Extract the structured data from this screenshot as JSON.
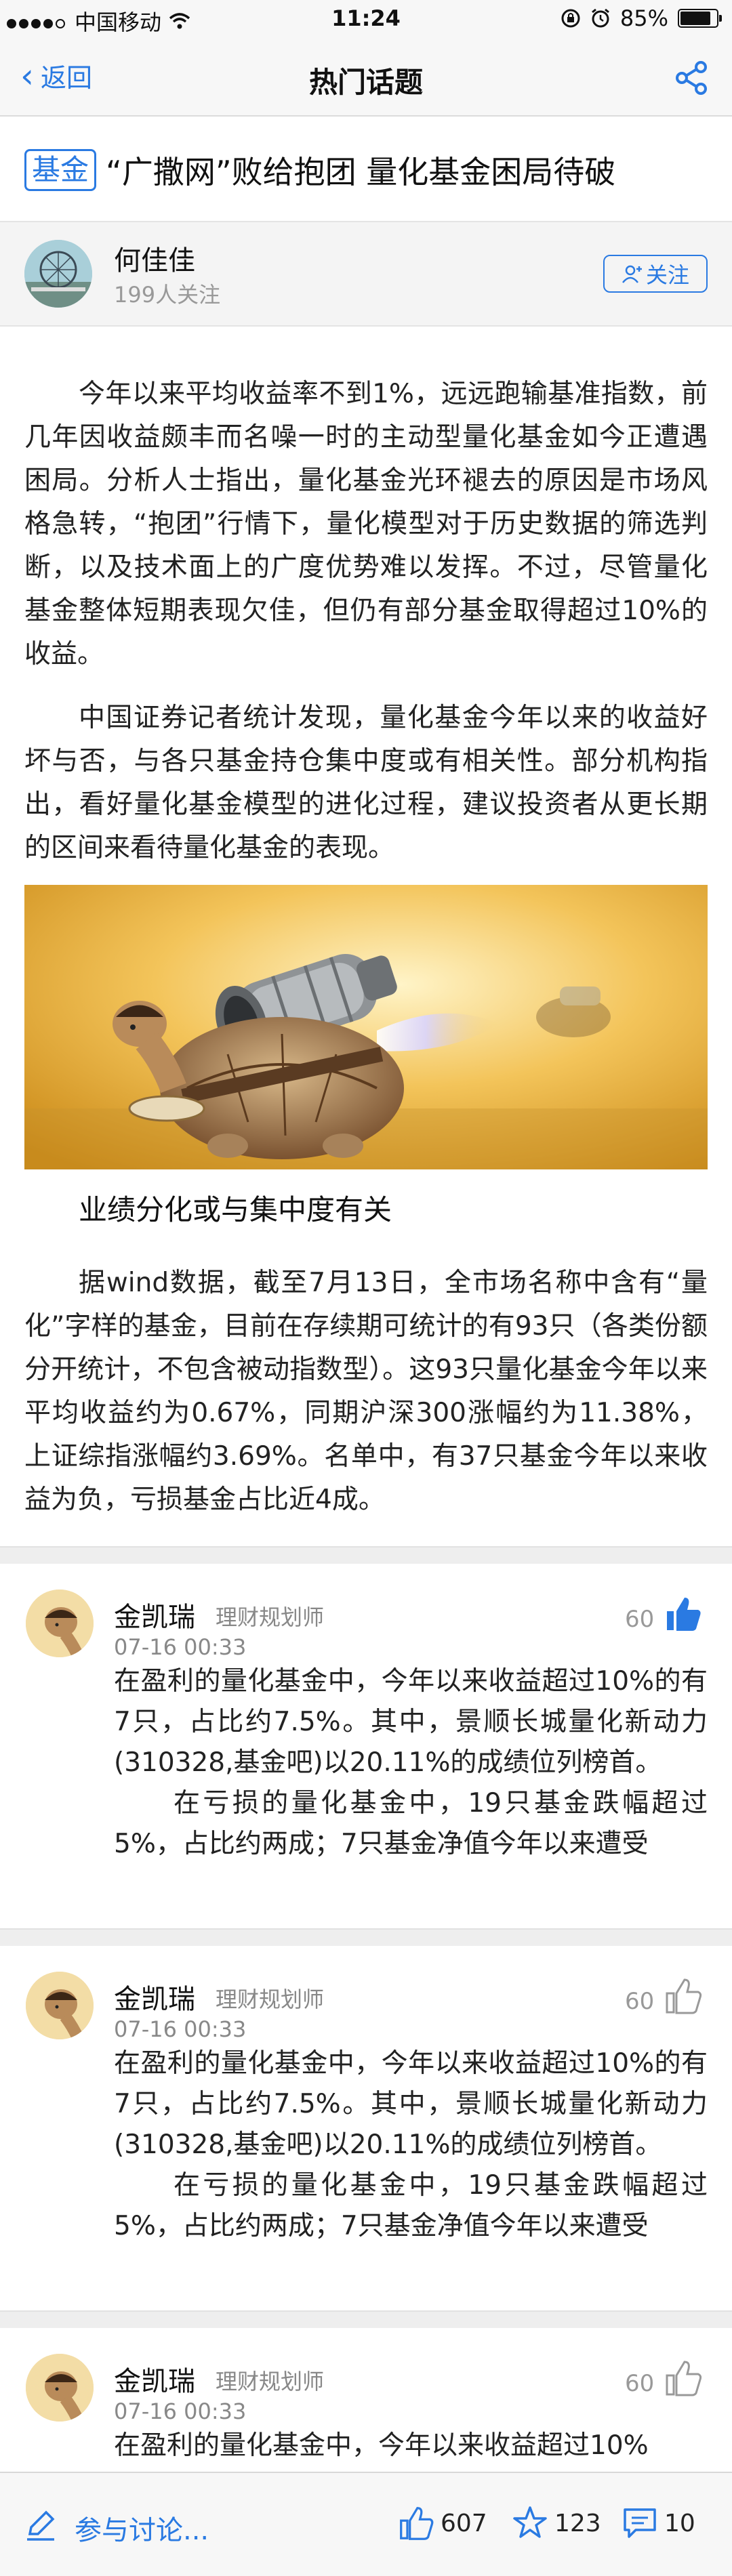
{
  "status_bar": {
    "carrier": "中国移动",
    "time": "11:24",
    "battery_percent": "85%",
    "battery_level": 0.85,
    "icons": [
      "signal-dots-icon",
      "wifi-icon",
      "lock-rotation-icon",
      "alarm-icon",
      "battery-icon"
    ]
  },
  "nav": {
    "back_label": "返回",
    "title": "热门话题",
    "share_icon": "share-icon"
  },
  "article": {
    "tag": "基金",
    "title": "“广撒网”败给抱团 量化基金困局待破",
    "author": {
      "name": "何佳佳",
      "followers": "199人关注",
      "follow_label": "关注"
    },
    "paragraphs": [
      "今年以来平均收益率不到1%，远远跑输基准指数，前几年因收益颇丰而名噪一时的主动型量化基金如今正遭遇困局。分析人士指出，量化基金光环褪去的原因是市场风格急转，“抱团”行情下，量化模型对于历史数据的筛选判断，以及技术面上的广度优势难以发挥。不过，尽管量化基金整体短期表现欠佳，但仍有部分基金取得超过10%的收益。",
      "中国证券记者统计发现，量化基金今年以来的收益好坏与否，与各只基金持仓集中度或有相关性。部分机构指出，看好量化基金模型的进化过程，建议投资者从更长期的区间来看待量化基金的表现。"
    ],
    "subheading": "业绩分化或与集中度有关",
    "paragraph_after_image": "据wind数据，截至7月13日，全市场名称中含有“量化”字样的基金，目前在存续期可统计的有93只（各类份额分开统计，不包含被动指数型）。这93只量化基金今年以来平均收益约为0.67%，同期沪深300涨幅约为11.38%，上证综指涨幅约3.69%。名单中，有37只基金今年以来收益为负，亏损基金占比近4成。"
  },
  "comments": [
    {
      "name": "金凯瑞",
      "role": "理财规划师",
      "time": "07-16 00:33",
      "likes": "60",
      "liked": true,
      "text1": "在盈利的量化基金中，今年以来收益超过10%的有7只，占比约7.5%。其中，景顺长城量化新动力(310328,基金吧)以20.11%的成绩位列榜首。",
      "text2": "在亏损的量化基金中，19只基金跌幅超过5%，占比约两成；7只基金净值今年以来遭受"
    },
    {
      "name": "金凯瑞",
      "role": "理财规划师",
      "time": "07-16 00:33",
      "likes": "60",
      "liked": false,
      "text1": "在盈利的量化基金中，今年以来收益超过10%的有7只，占比约7.5%。其中，景顺长城量化新动力(310328,基金吧)以20.11%的成绩位列榜首。",
      "text2": "在亏损的量化基金中，19只基金跌幅超过5%，占比约两成；7只基金净值今年以来遭受"
    },
    {
      "name": "金凯瑞",
      "role": "理财规划师",
      "time": "07-16 00:33",
      "likes": "60",
      "liked": false,
      "text1": "在盈利的量化基金中，今年以来收益超过10%"
    }
  ],
  "bottom_bar": {
    "discuss_label": "参与讨论...",
    "like_count": "607",
    "star_count": "123",
    "comment_count": "10"
  },
  "colors": {
    "accent": "#2a7ae2",
    "background": "#ffffff",
    "bar_background": "#f7f7f7",
    "divider": "#eeeeee"
  }
}
